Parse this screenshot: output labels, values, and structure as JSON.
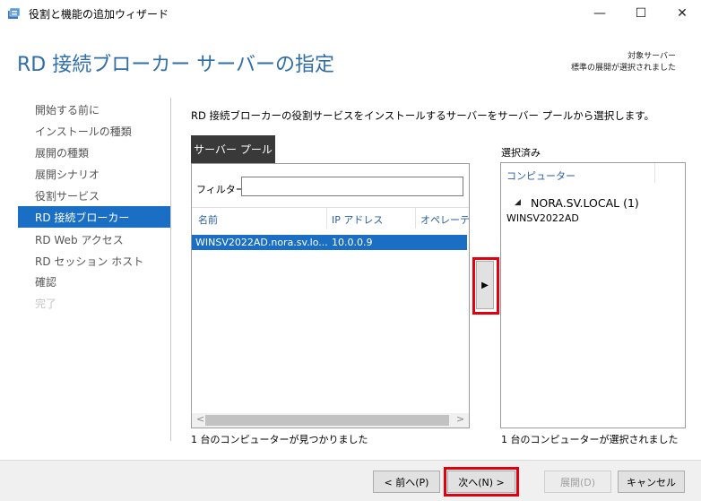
{
  "window": {
    "title": "役割と機能の追加ウィザード",
    "minimize": "—",
    "maximize": "☐",
    "close": "✕"
  },
  "header": {
    "heading": "RD 接続ブローカー サーバーの指定",
    "target_label": "対象サーバー",
    "target_value": "標準の展開が選択されました"
  },
  "nav": {
    "items": [
      {
        "label": "開始する前に"
      },
      {
        "label": "インストールの種類"
      },
      {
        "label": "展開の種類"
      },
      {
        "label": "展開シナリオ"
      },
      {
        "label": "役割サービス"
      },
      {
        "label": "RD 接続ブローカー"
      },
      {
        "label": "RD Web アクセス"
      },
      {
        "label": "RD セッション ホスト"
      },
      {
        "label": "確認"
      },
      {
        "label": "完了"
      }
    ]
  },
  "main": {
    "instruction": "RD 接続ブローカーの役割サービスをインストールするサーバーをサーバー プールから選択します。",
    "tab": "サーバー プール",
    "filter_label": "フィルター:",
    "filter_value": "",
    "columns": [
      "名前",
      "IP アドレス",
      "オペレーティ"
    ],
    "rows": [
      {
        "name": "WINSV2022AD.nora.sv.lo...",
        "ip": "10.0.0.9",
        "os": ""
      }
    ],
    "pool_status": "1 台のコンピューターが見つかりました",
    "add_arrow": "▶",
    "scroll_left": "<",
    "scroll_right": ">"
  },
  "selected": {
    "title": "選択済み",
    "column": "コンピューター",
    "group": "NORA.SV.LOCAL (1)",
    "group_arrow": "◢",
    "servers": [
      "WINSV2022AD"
    ],
    "status": "1 台のコンピューターが選択されました"
  },
  "footer": {
    "prev": "< 前へ(P)",
    "next": "次へ(N) >",
    "deploy": "展開(D)",
    "cancel": "キャンセル"
  },
  "colors": {
    "accent": "#1a6fc4",
    "heading": "#2f6ea8",
    "highlight": "#e2000f"
  }
}
